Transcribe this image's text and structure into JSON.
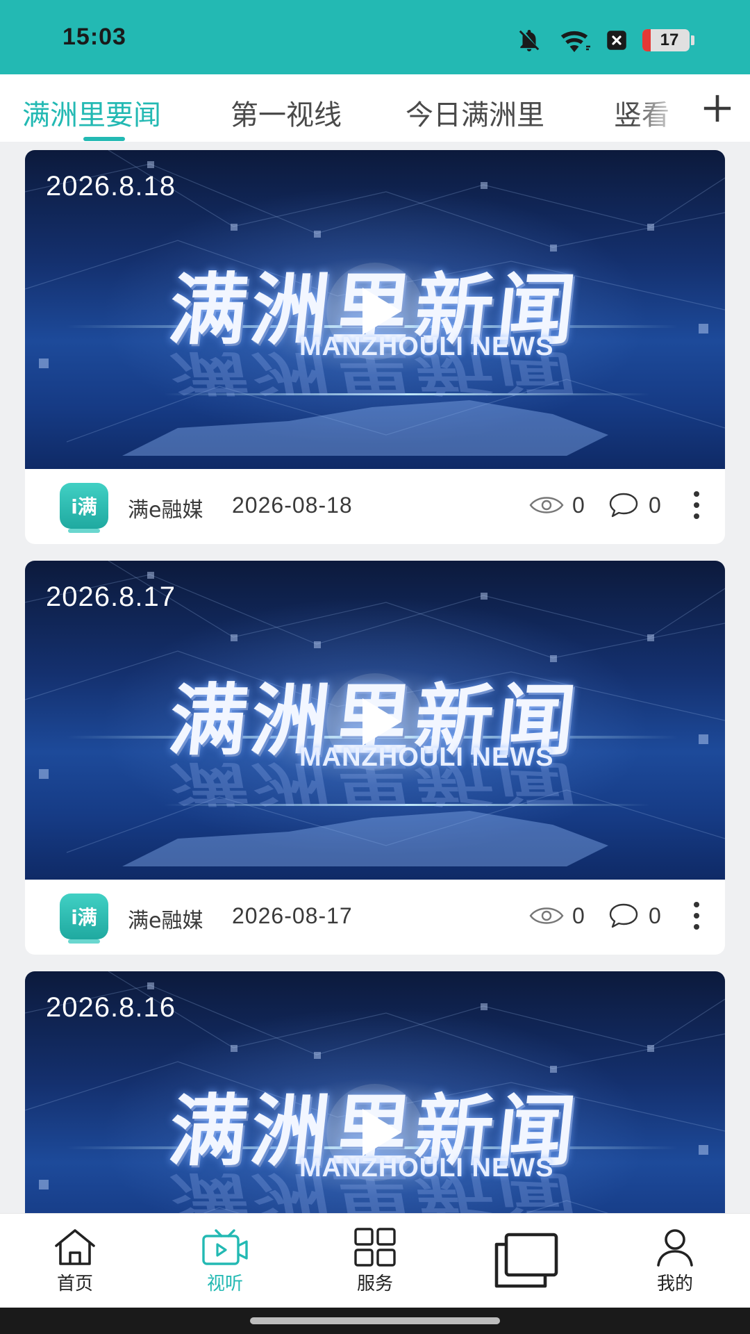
{
  "status_bar": {
    "time": "15:03",
    "battery": "17",
    "icons": [
      "bell-off-icon",
      "wifi-icon",
      "close-box-icon",
      "battery-icon"
    ]
  },
  "tabs": {
    "items": [
      {
        "label": "满洲里要闻",
        "active": true
      },
      {
        "label": "第一视线",
        "active": false
      },
      {
        "label": "今日满洲里",
        "active": false
      },
      {
        "label": "竖看",
        "active": false
      }
    ],
    "add_icon": "plus-icon"
  },
  "thumbnail": {
    "title": "满洲里新闻",
    "subtitle": "MANZHOULI NEWS"
  },
  "feed": [
    {
      "overlay_date": "2026.8.18",
      "source": "满e融媒",
      "date": "2026-08-18",
      "views": "0",
      "comments": "0"
    },
    {
      "overlay_date": "2026.8.17",
      "source": "满e融媒",
      "date": "2026-08-17",
      "views": "0",
      "comments": "0"
    },
    {
      "overlay_date": "2026.8.16"
    }
  ],
  "bottom_nav": [
    {
      "label": "首页",
      "icon": "home-icon",
      "active": false
    },
    {
      "label": "视听",
      "icon": "tv-play-icon",
      "active": true
    },
    {
      "label": "服务",
      "icon": "grid-icon",
      "active": false
    },
    {
      "label": "",
      "icon": "layers-icon",
      "active": false
    },
    {
      "label": "我的",
      "icon": "person-icon",
      "active": false
    }
  ],
  "colors": {
    "accent": "#23b9b3",
    "status_bar_bg": "#23b9b3",
    "battery_low": "#e53935",
    "page_bg": "#eff0f2"
  }
}
